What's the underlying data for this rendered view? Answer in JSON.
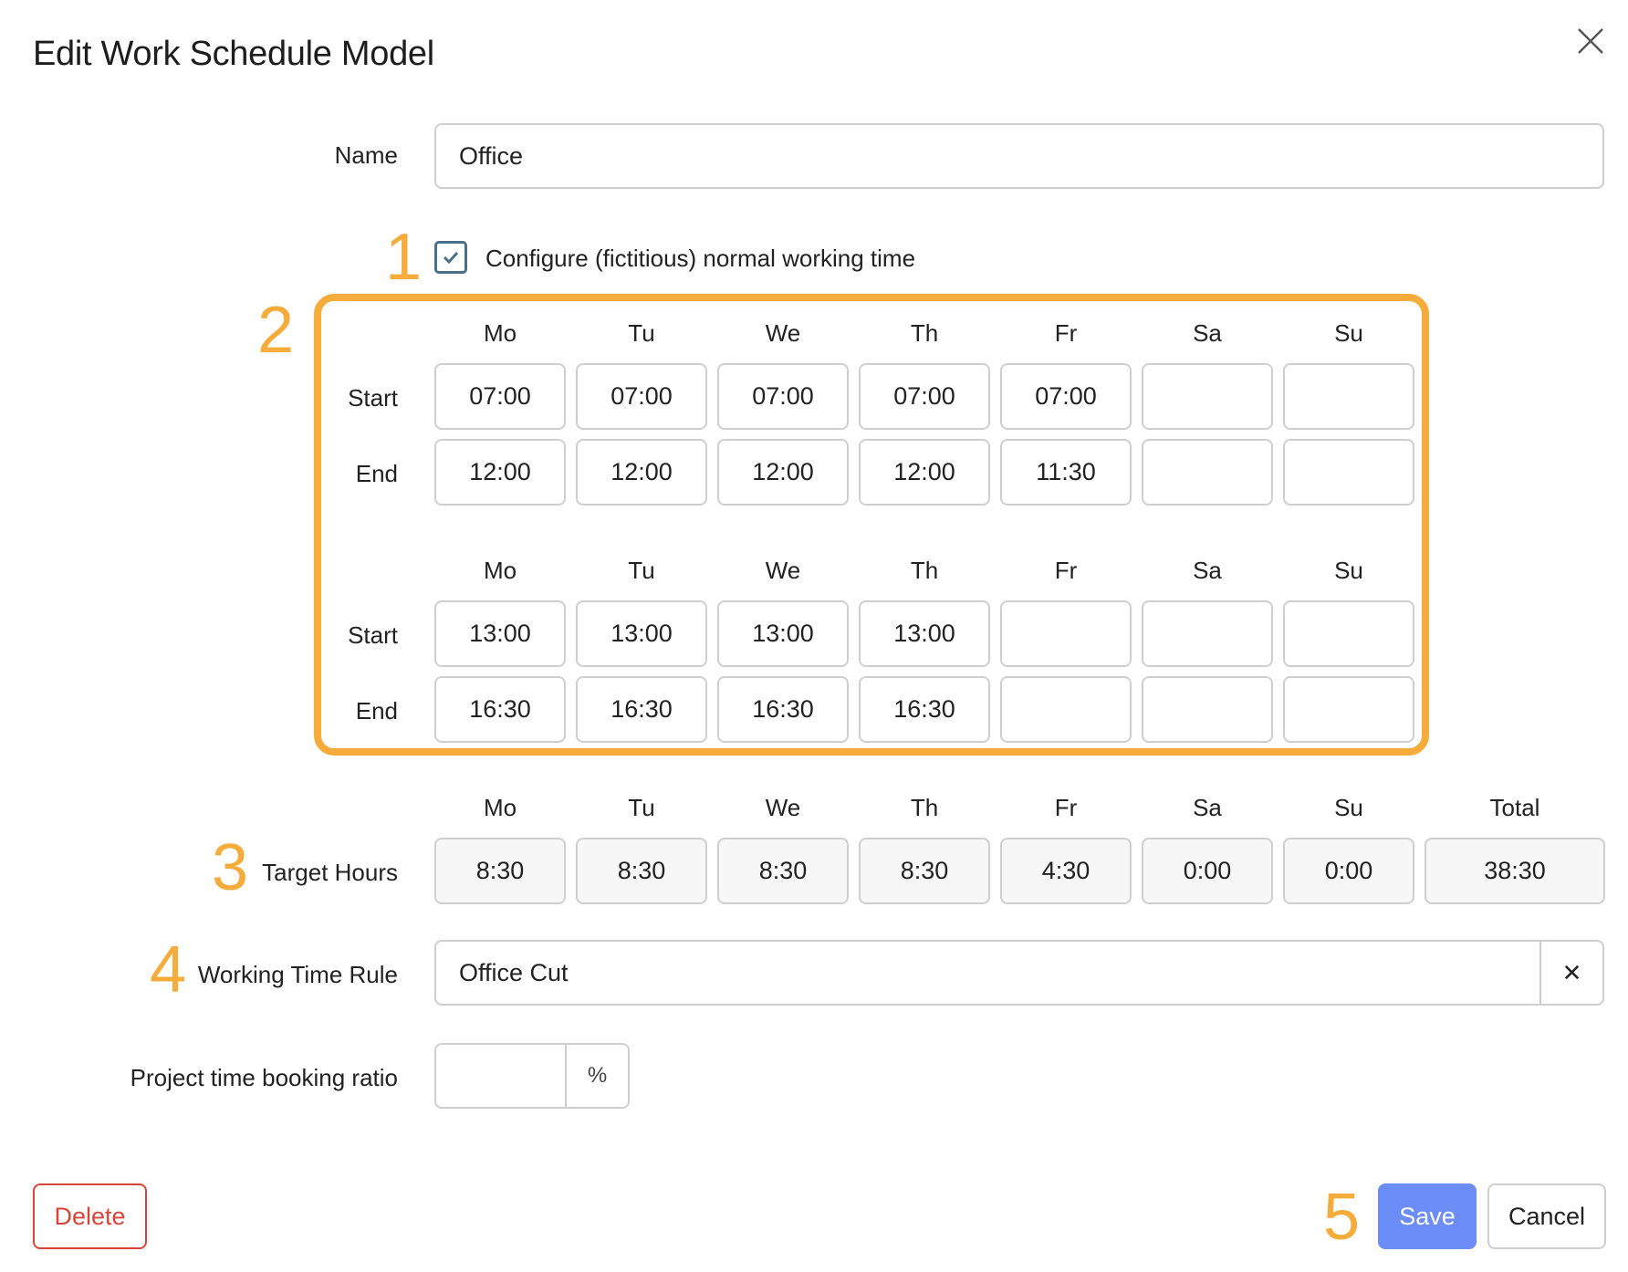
{
  "dialog": {
    "title": "Edit Work Schedule Model",
    "close_icon": "close-icon"
  },
  "name": {
    "label": "Name",
    "value": "Office"
  },
  "configure": {
    "label": "Configure (fictitious) normal working time",
    "checked": true
  },
  "days": [
    "Mo",
    "Tu",
    "We",
    "Th",
    "Fr",
    "Sa",
    "Su"
  ],
  "blocks": [
    {
      "start_label": "Start",
      "end_label": "End",
      "start": [
        "07:00",
        "07:00",
        "07:00",
        "07:00",
        "07:00",
        "",
        ""
      ],
      "end": [
        "12:00",
        "12:00",
        "12:00",
        "12:00",
        "11:30",
        "",
        ""
      ]
    },
    {
      "start_label": "Start",
      "end_label": "End",
      "start": [
        "13:00",
        "13:00",
        "13:00",
        "13:00",
        "",
        "",
        ""
      ],
      "end": [
        "16:30",
        "16:30",
        "16:30",
        "16:30",
        "",
        "",
        ""
      ]
    }
  ],
  "target": {
    "label": "Target Hours",
    "total_label": "Total",
    "values": [
      "8:30",
      "8:30",
      "8:30",
      "8:30",
      "4:30",
      "0:00",
      "0:00"
    ],
    "total": "38:30"
  },
  "rule": {
    "label": "Working Time Rule",
    "value": "Office Cut",
    "clear_symbol": "✕"
  },
  "ratio": {
    "label": "Project time booking ratio",
    "value": "",
    "unit": "%"
  },
  "buttons": {
    "delete": "Delete",
    "save": "Save",
    "cancel": "Cancel"
  },
  "callouts": [
    "1",
    "2",
    "3",
    "4",
    "5"
  ],
  "colors": {
    "accent": "#F5AC3B",
    "save_bg": "#6B8DF5",
    "delete_red": "#D9453B",
    "checkbox": "#4a6f8a"
  }
}
